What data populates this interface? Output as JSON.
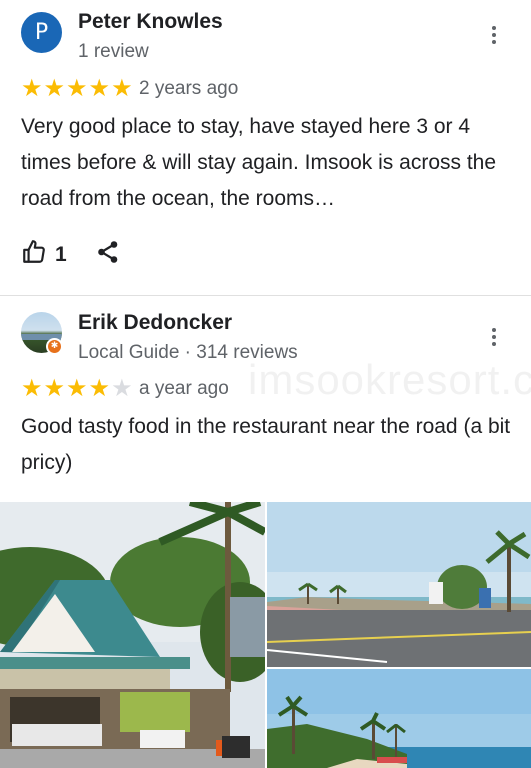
{
  "reviews": [
    {
      "avatar_letter": "P",
      "name": "Peter Knowles",
      "meta": "1 review",
      "rating": 5,
      "date": "2 years ago",
      "text": "Very good place to stay, have stayed here 3 or 4 times before & will stay again. Imsook is across the road from the ocean, the rooms…",
      "likes": "1"
    },
    {
      "name": "Erik Dedoncker",
      "meta": "Local Guide · 314 reviews",
      "rating": 4,
      "date": "a year ago",
      "text": "Good tasty food in the restaurant near the road (a bit pricy)"
    }
  ],
  "watermark": "imsookresort.com",
  "colors": {
    "star": "#fbbc04",
    "avatar": "#1a67b6",
    "local_guide_badge": "#e7711b"
  },
  "icons": [
    "thumbs-up-icon",
    "share-icon",
    "more-vert-icon",
    "star-icon"
  ]
}
